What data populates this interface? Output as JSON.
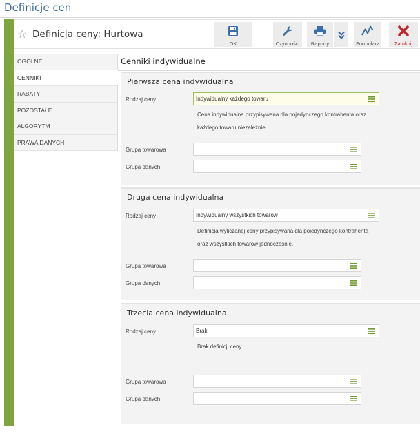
{
  "app": {
    "title": "Definicje cen"
  },
  "header": {
    "title": "Definicja ceny: Hurtowa"
  },
  "toolbar": {
    "ok": "OK",
    "czynnosci": "Czynności",
    "raporty": "Raporty",
    "formularz": "Formularz",
    "zamknij": "Zamknij"
  },
  "sidebar": {
    "items": [
      "OGÓLNE",
      "CENNIKI",
      "RABATY",
      "POZOSTAŁE",
      "ALGORYTM",
      "PRAWA DANYCH"
    ]
  },
  "content": {
    "title": "Cenniki indywidualne",
    "label_rodzaj": "Rodzaj ceny",
    "label_grupa_tow": "Grupa towarowa",
    "label_grupa_dan": "Grupa danych",
    "sections": [
      {
        "title": "Pierwsza cena indywidualna",
        "rodzaj": "Indywidualny każdego towaru",
        "desc1": "Cena indywidualna przypisywana dla pojedynczego kontrahenta oraz",
        "desc2": "każdego towaru niezależnie.",
        "grupa_towarowa": "",
        "grupa_danych": ""
      },
      {
        "title": "Druga cena indywidualna",
        "rodzaj": "Indywidualny wszystkich towarów",
        "desc1": "Definicja wyliczanej ceny przypisywana dla pojedynczego kontrahenta",
        "desc2": "oraz wszystkich towarów jednocześnie.",
        "grupa_towarowa": "",
        "grupa_danych": ""
      },
      {
        "title": "Trzecia cena indywidualna",
        "rodzaj": "Brak",
        "desc1": "Brak definicji ceny.",
        "desc2": "",
        "grupa_towarowa": "",
        "grupa_danych": ""
      }
    ]
  },
  "colors": {
    "accent_green": "#7fa540",
    "title_blue": "#3f6f9f",
    "icon_blue": "#3a6ea5",
    "close_red": "#c0262b",
    "list_icon_green": "#6f9a2f"
  }
}
